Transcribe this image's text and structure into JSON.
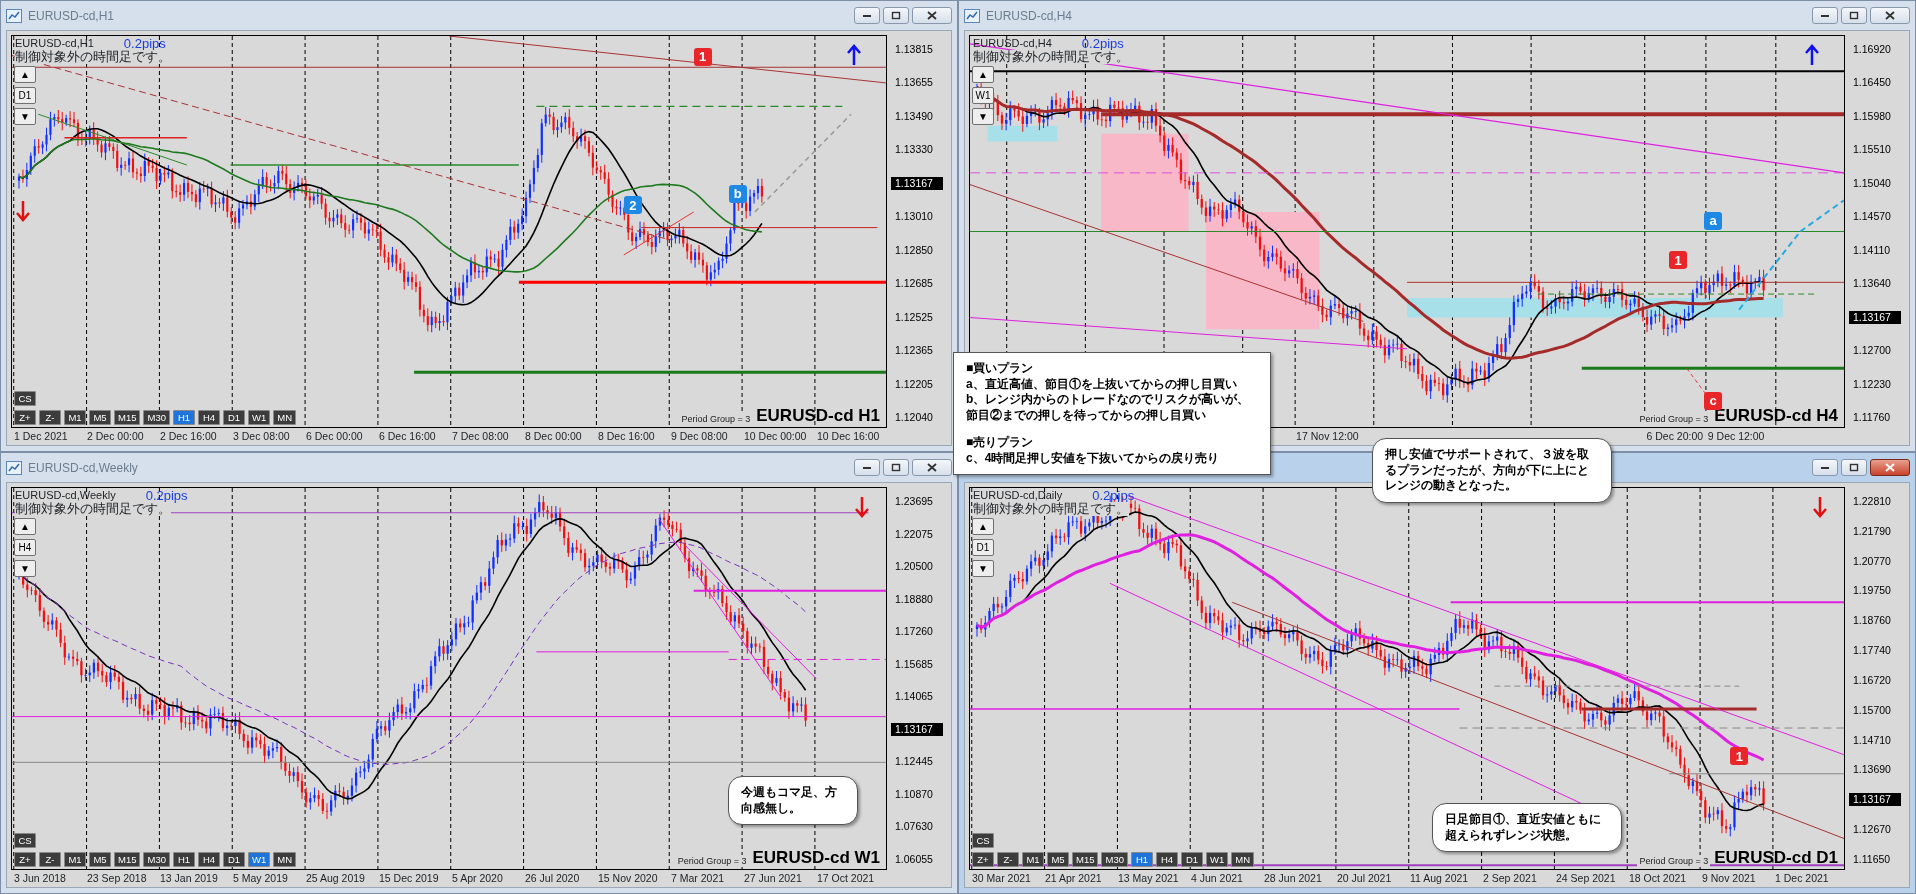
{
  "windows": [
    {
      "title": "EURUSD-cd,H1",
      "active": false,
      "chart_label": "EURUSD-cd,H1",
      "spread": "0.2pips",
      "notice": "制御対象外の時間足です。",
      "side_buttons": [
        "▲",
        "D1",
        "▼"
      ],
      "cs_button": "CS",
      "timeframes": [
        {
          "label": "Z+",
          "selected": false
        },
        {
          "label": "Z-",
          "selected": false
        },
        {
          "label": "M1",
          "selected": false
        },
        {
          "label": "M5",
          "selected": false
        },
        {
          "label": "M15",
          "selected": false
        },
        {
          "label": "M30",
          "selected": false
        },
        {
          "label": "H1",
          "selected": true
        },
        {
          "label": "H4",
          "selected": false
        },
        {
          "label": "D1",
          "selected": false
        },
        {
          "label": "W1",
          "selected": false
        },
        {
          "label": "MN",
          "selected": false
        }
      ],
      "symbol": "EURUSD-cd H1",
      "period_group": "Period Group = 3",
      "arrows": [
        {
          "kind": "up"
        },
        {
          "kind": "down"
        }
      ],
      "markers": [
        {
          "label": "1",
          "color": "#e8262a"
        },
        {
          "label": "2",
          "color": "#1e88e5"
        },
        {
          "label": "b",
          "color": "#1e88e5"
        }
      ],
      "price_ticks": [
        {
          "label": "1.13815",
          "current": false
        },
        {
          "label": "1.13655",
          "current": false
        },
        {
          "label": "1.13490",
          "current": false
        },
        {
          "label": "1.13330",
          "current": false
        },
        {
          "label": "1.13167",
          "current": true
        },
        {
          "label": "1.13010",
          "current": false
        },
        {
          "label": "1.12850",
          "current": false
        },
        {
          "label": "1.12685",
          "current": false
        },
        {
          "label": "1.12525",
          "current": false
        },
        {
          "label": "1.12365",
          "current": false
        },
        {
          "label": "1.12205",
          "current": false
        },
        {
          "label": "1.12040",
          "current": false
        }
      ],
      "time_labels": [
        "1 Dec 2021",
        "2 Dec 00:00",
        "2 Dec 16:00",
        "3 Dec 08:00",
        "6 Dec 00:00",
        "6 Dec 16:00",
        "7 Dec 08:00",
        "8 Dec 00:00",
        "8 Dec 16:00",
        "9 Dec 08:00",
        "10 Dec 00:00",
        "10 Dec 16:00"
      ]
    },
    {
      "title": "EURUSD-cd,H4",
      "active": false,
      "chart_label": "EURUSD-cd,H4",
      "spread": "0.2pips",
      "notice": "制御対象外の時間足です。",
      "side_buttons": [
        "▲",
        "W1",
        "▼"
      ],
      "symbol": "EURUSD-cd H4",
      "period_group": "Period Group = 3",
      "arrows": [
        {
          "kind": "up"
        }
      ],
      "markers": [
        {
          "label": "1",
          "color": "#e8262a"
        },
        {
          "label": "a",
          "color": "#1e88e5"
        },
        {
          "label": "c",
          "color": "#e8262a"
        }
      ],
      "price_ticks": [
        {
          "label": "1.16920",
          "current": false
        },
        {
          "label": "1.16450",
          "current": false
        },
        {
          "label": "1.15980",
          "current": false
        },
        {
          "label": "1.15510",
          "current": false
        },
        {
          "label": "1.15040",
          "current": false
        },
        {
          "label": "1.14570",
          "current": false
        },
        {
          "label": "1.14110",
          "current": false
        },
        {
          "label": "1.13640",
          "current": false
        },
        {
          "label": "1.13167",
          "current": true
        },
        {
          "label": "1.12700",
          "current": false
        },
        {
          "label": "1.12230",
          "current": false
        },
        {
          "label": "1.11760",
          "current": false
        }
      ],
      "time_labels": [
        "17 Nov 12:00",
        "6 Dec 20:00",
        "9 Dec 12:00"
      ]
    },
    {
      "title": "EURUSD-cd,Weekly",
      "active": false,
      "chart_label": "EURUSD-cd,Weekly",
      "spread": "0.2pips",
      "notice": "制御対象外の時間足です。",
      "side_buttons": [
        "▲",
        "H4",
        "▼"
      ],
      "cs_button": "CS",
      "timeframes": [
        {
          "label": "Z+",
          "selected": false
        },
        {
          "label": "Z-",
          "selected": false
        },
        {
          "label": "M1",
          "selected": false
        },
        {
          "label": "M5",
          "selected": false
        },
        {
          "label": "M15",
          "selected": false
        },
        {
          "label": "M30",
          "selected": false
        },
        {
          "label": "H1",
          "selected": false
        },
        {
          "label": "H4",
          "selected": false
        },
        {
          "label": "D1",
          "selected": false
        },
        {
          "label": "W1",
          "selected": true
        },
        {
          "label": "MN",
          "selected": false
        }
      ],
      "symbol": "EURUSD-cd W1",
      "period_group": "Period Group = 3",
      "arrows": [
        {
          "kind": "down"
        }
      ],
      "price_ticks": [
        {
          "label": "1.23695",
          "current": false
        },
        {
          "label": "1.22075",
          "current": false
        },
        {
          "label": "1.20500",
          "current": false
        },
        {
          "label": "1.18880",
          "current": false
        },
        {
          "label": "1.17260",
          "current": false
        },
        {
          "label": "1.15685",
          "current": false
        },
        {
          "label": "1.14065",
          "current": false
        },
        {
          "label": "1.13167",
          "current": true
        },
        {
          "label": "1.12445",
          "current": false
        },
        {
          "label": "1.10870",
          "current": false
        },
        {
          "label": "1.07630",
          "current": false
        },
        {
          "label": "1.06055",
          "current": false
        }
      ],
      "time_labels": [
        "3 Jun 2018",
        "23 Sep 2018",
        "13 Jan 2019",
        "5 May 2019",
        "25 Aug 2019",
        "15 Dec 2019",
        "5 Apr 2020",
        "26 Jul 2020",
        "15 Nov 2020",
        "7 Mar 2021",
        "27 Jun 2021",
        "17 Oct 2021"
      ]
    },
    {
      "active": true,
      "chart_label": "EURUSD-cd,Daily",
      "spread": "0.2pips",
      "notice": "制御対象外の時間足です。",
      "side_buttons": [
        "▲",
        "D1",
        "▼"
      ],
      "cs_button": "CS",
      "timeframes": [
        {
          "label": "Z+",
          "selected": false
        },
        {
          "label": "Z-",
          "selected": false
        },
        {
          "label": "M1",
          "selected": false
        },
        {
          "label": "M5",
          "selected": false
        },
        {
          "label": "M15",
          "selected": false
        },
        {
          "label": "M30",
          "selected": false
        },
        {
          "label": "H1",
          "selected": true
        },
        {
          "label": "H4",
          "selected": false
        },
        {
          "label": "D1",
          "selected": false
        },
        {
          "label": "W1",
          "selected": false
        },
        {
          "label": "MN",
          "selected": false
        }
      ],
      "symbol": "EURUSD-cd D1",
      "period_group": "Period Group = 3",
      "arrows": [
        {
          "kind": "down"
        }
      ],
      "markers": [
        {
          "label": "1",
          "color": "#e8262a"
        }
      ],
      "price_ticks": [
        {
          "label": "1.22810",
          "current": false
        },
        {
          "label": "1.21790",
          "current": false
        },
        {
          "label": "1.20770",
          "current": false
        },
        {
          "label": "1.19750",
          "current": false
        },
        {
          "label": "1.18760",
          "current": false
        },
        {
          "label": "1.17740",
          "current": false
        },
        {
          "label": "1.16720",
          "current": false
        },
        {
          "label": "1.15700",
          "current": false
        },
        {
          "label": "1.14710",
          "current": false
        },
        {
          "label": "1.13690",
          "current": false
        },
        {
          "label": "1.13167",
          "current": true
        },
        {
          "label": "1.12670",
          "current": false
        },
        {
          "label": "1.11650",
          "current": false
        }
      ],
      "time_labels": [
        "30 Mar 2021",
        "21 Apr 2021",
        "13 May 2021",
        "4 Jun 2021",
        "28 Jun 2021",
        "20 Jul 2021",
        "11 Aug 2021",
        "2 Sep 2021",
        "24 Sep 2021",
        "18 Oct 2021",
        "9 Nov 2021",
        "1 Dec 2021"
      ]
    }
  ],
  "callouts": [
    {
      "paragraphs": [
        {
          "kind": "heading",
          "text": "■買いプラン"
        },
        {
          "kind": "item",
          "text": "a、直近高値、節目①を上抜いてからの押し目買い"
        },
        {
          "kind": "item",
          "text": "b、レンジ内からのトレードなのでリスクが高いが、節目②までの押しを待ってからの押し目買い"
        },
        {
          "kind": "heading",
          "text": "■売りプラン"
        },
        {
          "kind": "item",
          "text": "c、4時間足押し安値を下抜いてからの戻り売り"
        }
      ]
    },
    {
      "paragraphs": [
        {
          "kind": "item",
          "text": "押し安値でサポートされて、３波を取るプランだったが、方向が下に上にとレンジの動きとなった。"
        }
      ]
    },
    {
      "paragraphs": [
        {
          "kind": "item",
          "text": "今週もコマ足、方向感無し。"
        }
      ]
    },
    {
      "paragraphs": [
        {
          "kind": "item",
          "text": "日足節目①、直近安値ともに超えられずレンジ状態。"
        }
      ]
    }
  ]
}
